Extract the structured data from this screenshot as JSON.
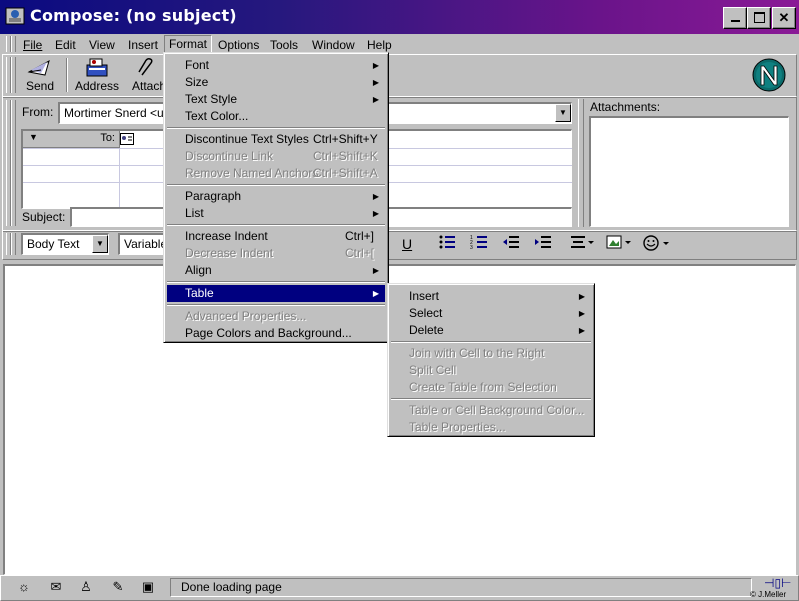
{
  "window": {
    "title": "Compose: (no subject)"
  },
  "menubar": {
    "items": [
      "File",
      "Edit",
      "View",
      "Insert",
      "Format",
      "Options",
      "Tools",
      "Window",
      "Help"
    ]
  },
  "toolbar": {
    "send": "Send",
    "address": "Address",
    "attach": "Attach"
  },
  "address": {
    "from_label": "From:",
    "from_value": "Mortimer Snerd <use",
    "to_label": "To:",
    "subject_label": "Subject:",
    "attachments_label": "Attachments:"
  },
  "format_toolbar": {
    "paragraph_style": "Body Text",
    "font": "Variable"
  },
  "format_menu": {
    "items": [
      {
        "label": "Font",
        "shortcut": "",
        "submenu": true,
        "disabled": false
      },
      {
        "label": "Size",
        "shortcut": "",
        "submenu": true,
        "disabled": false
      },
      {
        "label": "Text Style",
        "shortcut": "",
        "submenu": true,
        "disabled": false
      },
      {
        "label": "Text Color...",
        "shortcut": "",
        "submenu": false,
        "disabled": false
      },
      {
        "label": "Discontinue Text Styles",
        "shortcut": "Ctrl+Shift+Y",
        "submenu": false,
        "disabled": false
      },
      {
        "label": "Discontinue Link",
        "shortcut": "Ctrl+Shift+K",
        "submenu": false,
        "disabled": true
      },
      {
        "label": "Remove Named Anchors",
        "shortcut": "Ctrl+Shift+A",
        "submenu": false,
        "disabled": true
      },
      {
        "label": "Paragraph",
        "shortcut": "",
        "submenu": true,
        "disabled": false
      },
      {
        "label": "List",
        "shortcut": "",
        "submenu": true,
        "disabled": false
      },
      {
        "label": "Increase Indent",
        "shortcut": "Ctrl+]",
        "submenu": false,
        "disabled": false
      },
      {
        "label": "Decrease Indent",
        "shortcut": "Ctrl+[",
        "submenu": false,
        "disabled": true
      },
      {
        "label": "Align",
        "shortcut": "",
        "submenu": true,
        "disabled": false
      },
      {
        "label": "Table",
        "shortcut": "",
        "submenu": true,
        "disabled": false
      },
      {
        "label": "Advanced Properties...",
        "shortcut": "",
        "submenu": false,
        "disabled": true
      },
      {
        "label": "Page Colors and Background...",
        "shortcut": "",
        "submenu": false,
        "disabled": false
      }
    ]
  },
  "table_submenu": {
    "items": [
      {
        "label": "Insert",
        "submenu": true,
        "disabled": false
      },
      {
        "label": "Select",
        "submenu": true,
        "disabled": false
      },
      {
        "label": "Delete",
        "submenu": true,
        "disabled": false
      },
      {
        "label": "Join with Cell to the Right",
        "submenu": false,
        "disabled": true
      },
      {
        "label": "Split Cell",
        "submenu": false,
        "disabled": true
      },
      {
        "label": "Create Table from Selection",
        "submenu": false,
        "disabled": true
      },
      {
        "label": "Table or Cell Background Color...",
        "submenu": false,
        "disabled": true
      },
      {
        "label": "Table Properties...",
        "submenu": false,
        "disabled": true
      }
    ]
  },
  "statusbar": {
    "text": "Done loading page",
    "credit": "© J.Meller"
  },
  "colors": {
    "highlight": "#000080",
    "chrome": "#c0c0c0",
    "title_start": "#0a0a80",
    "title_end": "#8a1a96"
  }
}
